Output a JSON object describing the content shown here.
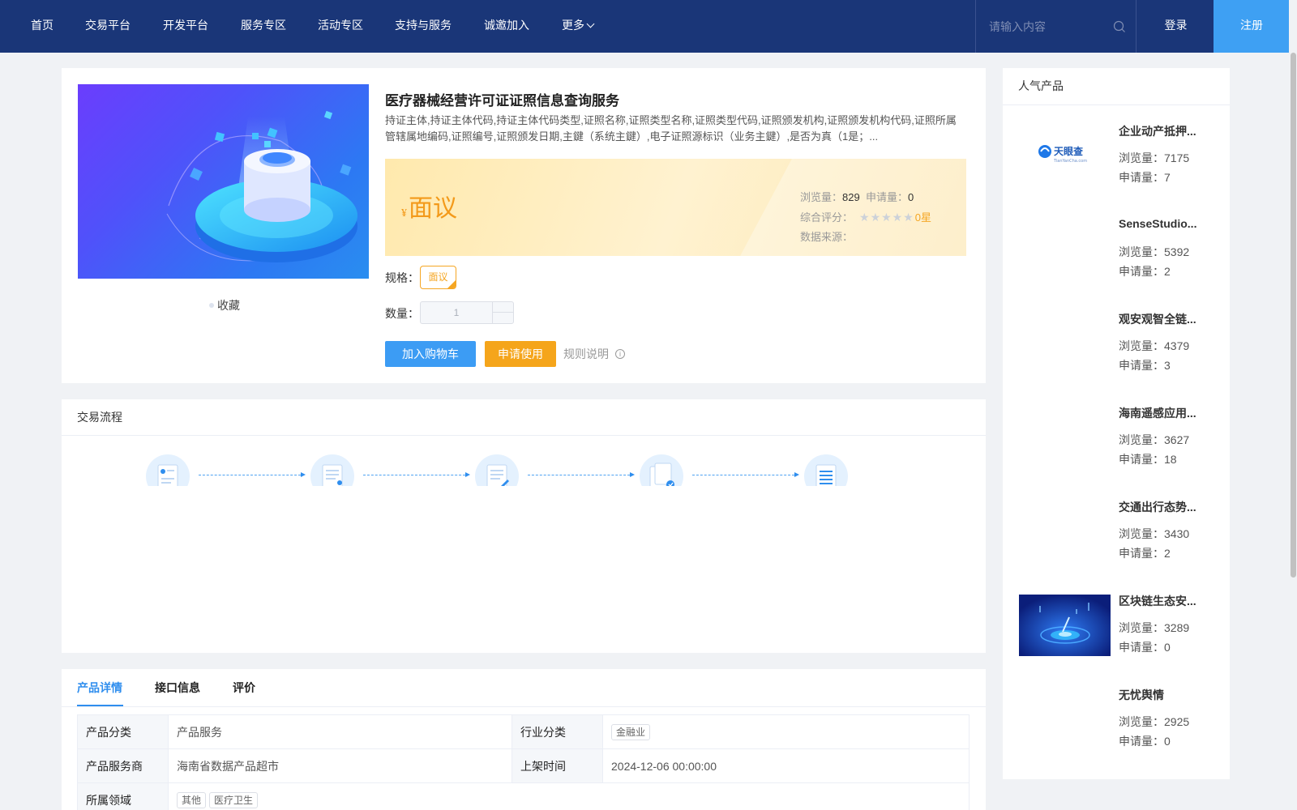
{
  "nav": {
    "items": [
      "首页",
      "交易平台",
      "开发平台",
      "服务专区",
      "活动专区",
      "支持与服务",
      "诚邀加入",
      "更多"
    ],
    "search_placeholder": "请输入内容",
    "login": "登录",
    "register": "注册"
  },
  "product": {
    "title": "医疗器械经营许可证证照信息查询服务",
    "description": "持证主体,持证主体代码,持证主体代码类型,证照名称,证照类型名称,证照类型代码,证照颁发机构,证照颁发机构代码,证照所属管辖属地编码,证照编号,证照颁发日期,主鍵（系统主鍵）,电子证照源标识（业务主鍵）,是否为真（1是；...",
    "favorite": "收藏",
    "price": {
      "currency": "¥",
      "value": "面议",
      "views_label": "浏览量：",
      "views": "829",
      "applies_label": "申请量：",
      "applies": "0",
      "rating_label": "综合评分：",
      "rating_stars": 0,
      "rating_text": "0星",
      "source_label": "数据来源："
    },
    "spec_label": "规格：",
    "spec_option": "面议",
    "qty_label": "数量：",
    "qty_value": "1",
    "add_cart": "加入购物车",
    "apply": "申请使用",
    "rules": "规则说明"
  },
  "flow": {
    "title": "交易流程",
    "steps": 5
  },
  "details": {
    "tabs": [
      "产品详情",
      "接口信息",
      "评价"
    ],
    "active_tab": 0,
    "rows": [
      {
        "k1": "产品分类",
        "v1": "产品服务",
        "k2": "行业分类",
        "v2_tags": [
          "金融业"
        ]
      },
      {
        "k1": "产品服务商",
        "v1": "海南省数据产品超市",
        "k2": "上架时间",
        "v2": "2024-12-06 00:00:00"
      },
      {
        "k1": "所属领域",
        "v1_tags": [
          "其他",
          "医疗卫生"
        ]
      }
    ]
  },
  "popular": {
    "title": "人气产品",
    "views_label": "浏览量：",
    "applies_label": "申请量：",
    "items": [
      {
        "title": "企业动产抵押...",
        "views": "7175",
        "applies": "7",
        "thumb": "tianyancha-logo"
      },
      {
        "title": "SenseStudio...",
        "views": "5392",
        "applies": "2",
        "thumb": "blank"
      },
      {
        "title": "观安观智全链...",
        "views": "4379",
        "applies": "3",
        "thumb": "blank"
      },
      {
        "title": "海南遥感应用...",
        "views": "3627",
        "applies": "18",
        "thumb": "blank"
      },
      {
        "title": "交通出行态势...",
        "views": "3430",
        "applies": "2",
        "thumb": "blank"
      },
      {
        "title": "区块链生态安...",
        "views": "3289",
        "applies": "0",
        "thumb": "blockchain-image"
      },
      {
        "title": "无忧舆情",
        "views": "2925",
        "applies": "0",
        "thumb": "blank"
      }
    ],
    "logo_text": "天眼查",
    "logo_sub": "TianYanCha.com"
  },
  "colors": {
    "nav_bg": "#1a3678",
    "accent": "#2f8eee",
    "orange": "#f5a51b",
    "register_bg": "#3ea0f3"
  }
}
